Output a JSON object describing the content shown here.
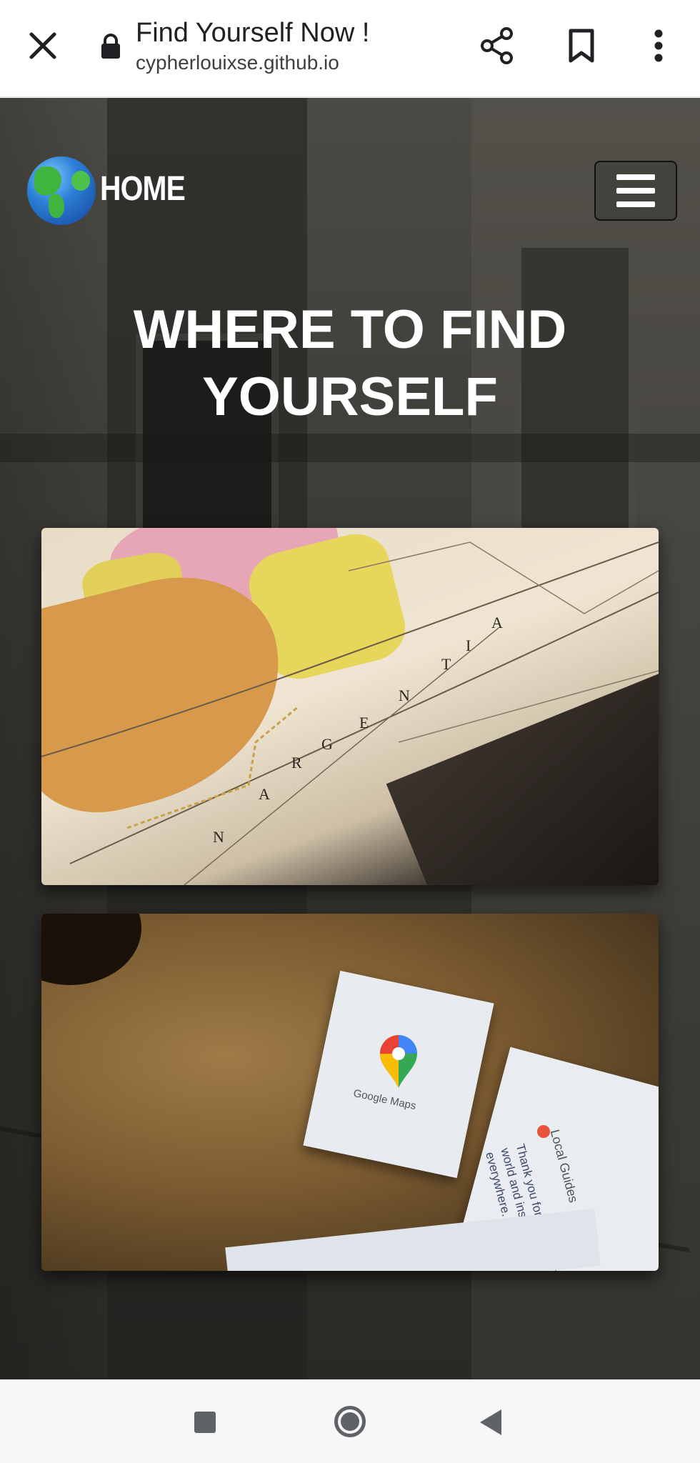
{
  "browser": {
    "title": "Find Yourself Now !",
    "url": "cypherlouixse.github.io",
    "icons": {
      "close": "close-icon",
      "lock": "lock-icon",
      "share": "share-icon",
      "bookmark": "bookmark-icon",
      "menu": "more-vert-icon"
    }
  },
  "page": {
    "nav": {
      "logo_icon": "globe-icon",
      "home_label": "HOME",
      "menu_icon": "hamburger-icon"
    },
    "hero_title": "WHERE TO FIND YOURSELF",
    "cards": [
      {
        "image": "map-image",
        "map_letters": [
          "A",
          "R",
          "G",
          "E",
          "N",
          "T",
          "I",
          "N",
          "A"
        ]
      },
      {
        "image": "google-maps-pin-image",
        "card_label": "Google Maps",
        "guides_label": "Local Guides",
        "guides_text": "Thank you for sharing your world and inspiring people everywhere."
      }
    ]
  },
  "system_nav": {
    "recent": "recent-apps-icon",
    "home": "home-icon",
    "back": "back-icon"
  },
  "colors": {
    "hero_text": "#ffffff",
    "browser_bg": "#ffffff",
    "nav_bar_bg": "#f7f7f7"
  }
}
